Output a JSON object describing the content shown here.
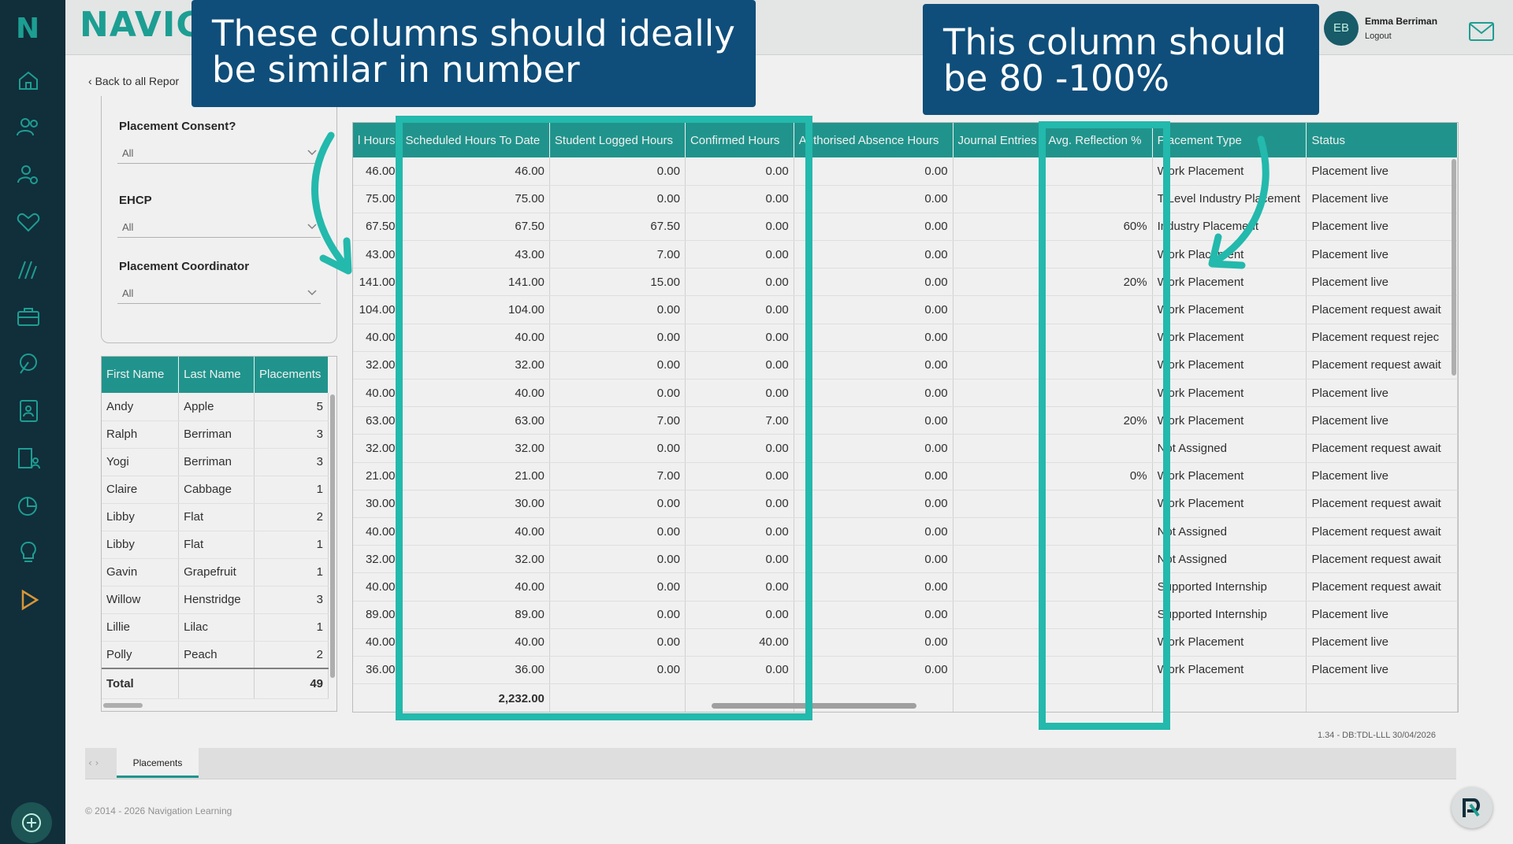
{
  "app": {
    "brand": "NAVIGA",
    "logo_letter": "N"
  },
  "user": {
    "initials": "EB",
    "name": "Emma Berriman",
    "logout_label": "Logout"
  },
  "back_label": "Back to all Repor",
  "filters": {
    "consent_label": "Placement Consent?",
    "consent_value": "All",
    "ehcp_label": "EHCP",
    "ehcp_value": "All",
    "coordinator_label": "Placement Coordinator",
    "coordinator_value": "All"
  },
  "students": {
    "headers": [
      "First Name",
      "Last Name",
      "Placements"
    ],
    "rows": [
      [
        "Andy",
        "Apple",
        "5"
      ],
      [
        "Ralph",
        "Berriman",
        "3"
      ],
      [
        "Yogi",
        "Berriman",
        "3"
      ],
      [
        "Claire",
        "Cabbage",
        "1"
      ],
      [
        "Libby",
        "Flat",
        "2"
      ],
      [
        "Libby",
        "Flat",
        "1"
      ],
      [
        "Gavin",
        "Grapefruit",
        "1"
      ],
      [
        "Willow",
        "Henstridge",
        "3"
      ],
      [
        "Lillie",
        "Lilac",
        "1"
      ],
      [
        "Polly",
        "Peach",
        "2"
      ]
    ],
    "total_label": "Total",
    "total_value": "49"
  },
  "placements": {
    "headers": [
      "l Hours",
      "Scheduled Hours To Date",
      "Student Logged Hours",
      "Confirmed Hours",
      "Authorised Absence Hours",
      "Journal Entries",
      "Avg. Reflection %",
      "Placement Type",
      "Status"
    ],
    "rows": [
      [
        "46.00",
        "46.00",
        "0.00",
        "0.00",
        "0.00",
        "",
        "",
        "Work Placement",
        "Placement live"
      ],
      [
        "75.00",
        "75.00",
        "0.00",
        "0.00",
        "0.00",
        "",
        "",
        "T Level Industry Placement",
        "Placement live"
      ],
      [
        "67.50",
        "67.50",
        "67.50",
        "0.00",
        "0.00",
        "",
        "60%",
        "Industry Placement",
        "Placement live"
      ],
      [
        "43.00",
        "43.00",
        "7.00",
        "0.00",
        "0.00",
        "",
        "",
        "Work Placement",
        "Placement live"
      ],
      [
        "141.00",
        "141.00",
        "15.00",
        "0.00",
        "0.00",
        "",
        "20%",
        "Work Placement",
        "Placement live"
      ],
      [
        "104.00",
        "104.00",
        "0.00",
        "0.00",
        "0.00",
        "",
        "",
        "Work Placement",
        "Placement request await"
      ],
      [
        "40.00",
        "40.00",
        "0.00",
        "0.00",
        "0.00",
        "",
        "",
        "Work Placement",
        "Placement request rejec"
      ],
      [
        "32.00",
        "32.00",
        "0.00",
        "0.00",
        "0.00",
        "",
        "",
        "Work Placement",
        "Placement request await"
      ],
      [
        "40.00",
        "40.00",
        "0.00",
        "0.00",
        "0.00",
        "",
        "",
        "Work Placement",
        "Placement live"
      ],
      [
        "63.00",
        "63.00",
        "7.00",
        "7.00",
        "0.00",
        "",
        "20%",
        "Work Placement",
        "Placement live"
      ],
      [
        "32.00",
        "32.00",
        "0.00",
        "0.00",
        "0.00",
        "",
        "",
        "Not Assigned",
        "Placement request await"
      ],
      [
        "21.00",
        "21.00",
        "7.00",
        "0.00",
        "0.00",
        "",
        "0%",
        "Work Placement",
        "Placement live"
      ],
      [
        "30.00",
        "30.00",
        "0.00",
        "0.00",
        "0.00",
        "",
        "",
        "Work Placement",
        "Placement request await"
      ],
      [
        "40.00",
        "40.00",
        "0.00",
        "0.00",
        "0.00",
        "",
        "",
        "Not Assigned",
        "Placement request await"
      ],
      [
        "32.00",
        "32.00",
        "0.00",
        "0.00",
        "0.00",
        "",
        "",
        "Not Assigned",
        "Placement request await"
      ],
      [
        "40.00",
        "40.00",
        "0.00",
        "0.00",
        "0.00",
        "",
        "",
        "Supported Internship",
        "Placement request await"
      ],
      [
        "89.00",
        "89.00",
        "0.00",
        "0.00",
        "0.00",
        "",
        "",
        "Supported Internship",
        "Placement live"
      ],
      [
        "40.00",
        "40.00",
        "0.00",
        "40.00",
        "0.00",
        "",
        "",
        "Work Placement",
        "Placement live"
      ],
      [
        "36.00",
        "36.00",
        "0.00",
        "0.00",
        "0.00",
        "",
        "",
        "Work Placement",
        "Placement live"
      ]
    ],
    "total_scheduled": "2,232.00"
  },
  "annotations": {
    "left": "These columns should ideally be similar in number",
    "right": "This column should be 80 -100%"
  },
  "colors": {
    "accent": "#239e95",
    "callout": "#0f4e7a",
    "frame": "#23b9ac",
    "sidebar": "#13313f"
  },
  "version": "1.34 - DB:TDL-LLL 30/04/2026",
  "tab_label": "Placements",
  "footer": "© 2014 - 2026 Navigation Learning"
}
